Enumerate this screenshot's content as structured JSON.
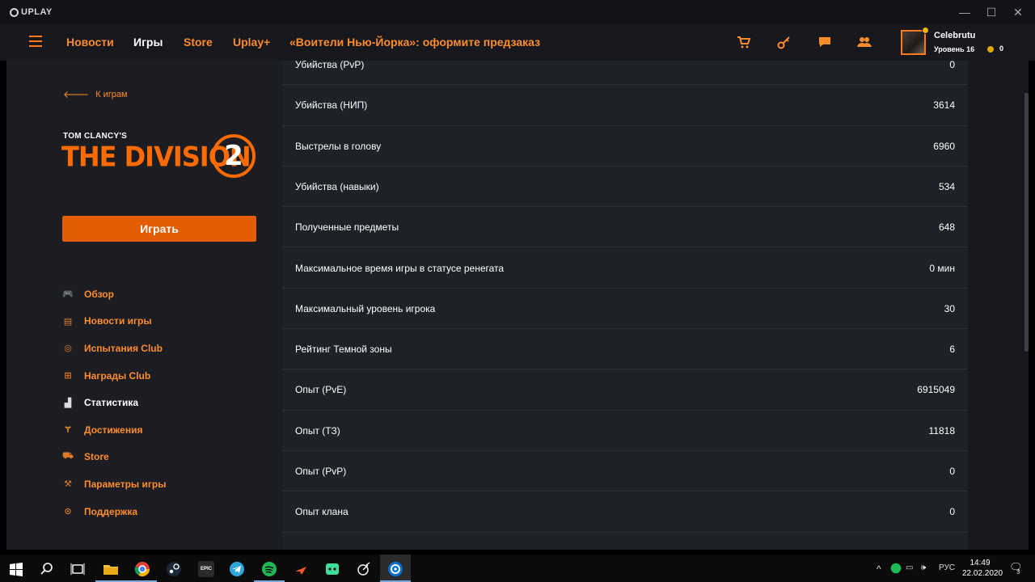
{
  "titlebar": {
    "app_name": "UPLAY",
    "minimize": "—",
    "maximize": "☐",
    "close": "✕"
  },
  "header": {
    "nav": [
      "Новости",
      "Игры",
      "Store",
      "Uplay+",
      "«Воители Нью-Йорка»: оформите предзаказ"
    ],
    "active_nav": "Игры",
    "icons": [
      "cart-icon",
      "key-icon",
      "chat-icon",
      "friends-icon"
    ],
    "user": {
      "name": "Celebrutu",
      "level": "Уровень 16",
      "coins": "0"
    }
  },
  "sidebar": {
    "back_label": "К играм",
    "game_logo": {
      "brand": "TOM CLANCY'S",
      "title": "THE DIVISION",
      "number": "2"
    },
    "play_label": "Играть",
    "menu": [
      {
        "label": "Обзор",
        "icon": "gamepad-icon"
      },
      {
        "label": "Новости игры",
        "icon": "news-icon"
      },
      {
        "label": "Испытания Club",
        "icon": "target-icon"
      },
      {
        "label": "Награды Club",
        "icon": "gift-icon"
      },
      {
        "label": "Статистика",
        "icon": "stats-icon"
      },
      {
        "label": "Достижения",
        "icon": "trophy-icon"
      },
      {
        "label": "Store",
        "icon": "cart-icon"
      },
      {
        "label": "Параметры игры",
        "icon": "wrench-icon"
      },
      {
        "label": "Поддержка",
        "icon": "support-icon"
      }
    ],
    "active_menu": "Статистика"
  },
  "stats": {
    "rows": [
      {
        "label": "Убийства (PvP)",
        "value": "0"
      },
      {
        "label": "Убийства (НИП)",
        "value": "3614"
      },
      {
        "label": "Выстрелы в голову",
        "value": "6960"
      },
      {
        "label": "Убийства (навыки)",
        "value": "534"
      },
      {
        "label": "Полученные предметы",
        "value": "648"
      },
      {
        "label": "Максимальное время игры в статусе ренегата",
        "value": "0 мин"
      },
      {
        "label": "Максимальный уровень игрока",
        "value": "30"
      },
      {
        "label": "Рейтинг Темной зоны",
        "value": "6"
      },
      {
        "label": "Опыт (PvE)",
        "value": "6915049"
      },
      {
        "label": "Опыт (ТЗ)",
        "value": "11818"
      },
      {
        "label": "Опыт (PvP)",
        "value": "0"
      },
      {
        "label": "Опыт клана",
        "value": "0"
      }
    ]
  },
  "taskbar": {
    "apps": [
      "windows-start-icon",
      "search-icon",
      "task-view-icon",
      "file-explorer-icon",
      "chrome-icon",
      "steam-icon",
      "epic-games-icon",
      "telegram-icon",
      "spotify-icon",
      "arrow-app-icon",
      "discord-like-icon",
      "satellite-icon",
      "uplay-icon"
    ],
    "epic_label": "EPIC",
    "language": "РУС",
    "time": "14:49",
    "date": "22.02.2020",
    "notifications": "3"
  },
  "colors": {
    "accent": "#ff8c2b",
    "play_button": "#e25d00",
    "header_bg": "#16181e",
    "sidebar_bg": "#1b1d22",
    "content_bg": "#1e2127"
  }
}
